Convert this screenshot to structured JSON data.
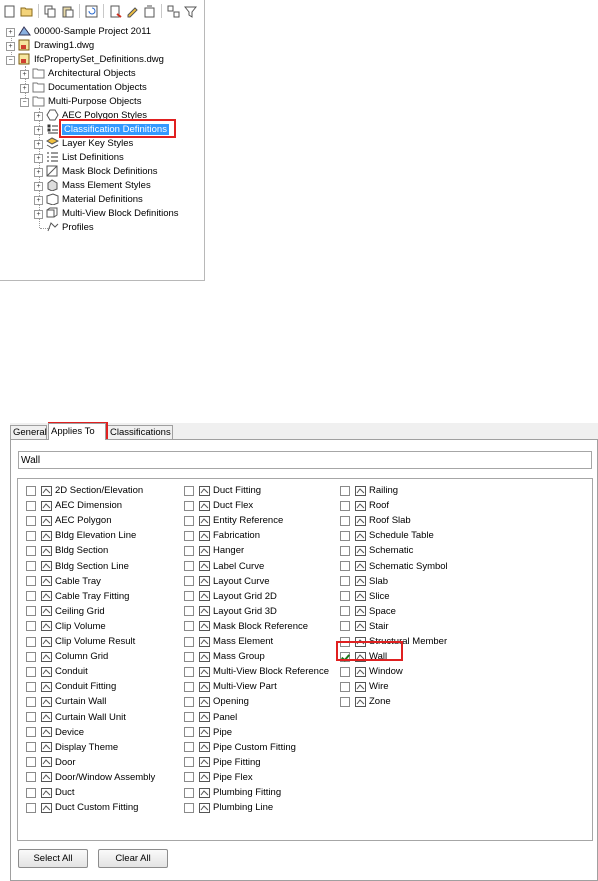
{
  "toolbar": {
    "icons": [
      "new-icon",
      "open-icon",
      "copy-icon",
      "paste-icon",
      "refresh-icon",
      "properties-icon",
      "rename-icon",
      "purge-icon",
      "manage-icon",
      "filter-icon"
    ]
  },
  "tree": {
    "items": [
      {
        "label": "00000-Sample Project 2011",
        "icon": "project-icon",
        "expander": "+"
      },
      {
        "label": "Drawing1.dwg",
        "icon": "drawing-icon",
        "expander": "+"
      },
      {
        "label": "IfcPropertySet_Definitions.dwg",
        "icon": "drawing-icon",
        "expander": "−"
      },
      {
        "label": "Architectural Objects",
        "icon": "folder-icon",
        "expander": "+"
      },
      {
        "label": "Documentation Objects",
        "icon": "folder-icon",
        "expander": "+"
      },
      {
        "label": "Multi-Purpose Objects",
        "icon": "folder-icon",
        "expander": "−"
      },
      {
        "label": "AEC Polygon Styles",
        "icon": "polygon-icon",
        "expander": "+"
      },
      {
        "label": "Classification Definitions",
        "icon": "classification-icon",
        "expander": "+",
        "selected": true
      },
      {
        "label": "Layer Key Styles",
        "icon": "layer-key-icon",
        "expander": "+"
      },
      {
        "label": "List Definitions",
        "icon": "list-icon",
        "expander": "+"
      },
      {
        "label": "Mask Block Definitions",
        "icon": "mask-block-icon",
        "expander": "+"
      },
      {
        "label": "Mass Element Styles",
        "icon": "mass-element-icon",
        "expander": "+"
      },
      {
        "label": "Material Definitions",
        "icon": "material-icon",
        "expander": "+"
      },
      {
        "label": "Multi-View Block Definitions",
        "icon": "multiview-block-icon",
        "expander": "+"
      },
      {
        "label": "Profiles",
        "icon": "profile-icon",
        "expander": ""
      }
    ]
  },
  "dialog": {
    "tabs": [
      "General",
      "Applies To",
      "Classifications"
    ],
    "active_tab": "Applies To",
    "filter_value": "Wall",
    "col1": [
      {
        "label": "2D Section/Elevation",
        "checked": false
      },
      {
        "label": "AEC Dimension",
        "checked": false
      },
      {
        "label": "AEC Polygon",
        "checked": false
      },
      {
        "label": "Bldg Elevation Line",
        "checked": false
      },
      {
        "label": "Bldg Section",
        "checked": false
      },
      {
        "label": "Bldg Section Line",
        "checked": false
      },
      {
        "label": "Cable Tray",
        "checked": false
      },
      {
        "label": "Cable Tray Fitting",
        "checked": false
      },
      {
        "label": "Ceiling Grid",
        "checked": false
      },
      {
        "label": "Clip Volume",
        "checked": false
      },
      {
        "label": "Clip Volume Result",
        "checked": false
      },
      {
        "label": "Column Grid",
        "checked": false
      },
      {
        "label": "Conduit",
        "checked": false
      },
      {
        "label": "Conduit Fitting",
        "checked": false
      },
      {
        "label": "Curtain Wall",
        "checked": false
      },
      {
        "label": "Curtain Wall Unit",
        "checked": false
      },
      {
        "label": "Device",
        "checked": false
      },
      {
        "label": "Display Theme",
        "checked": false
      },
      {
        "label": "Door",
        "checked": false
      },
      {
        "label": "Door/Window Assembly",
        "checked": false
      },
      {
        "label": "Duct",
        "checked": false
      },
      {
        "label": "Duct Custom Fitting",
        "checked": false
      }
    ],
    "col2": [
      {
        "label": "Duct Fitting",
        "checked": false
      },
      {
        "label": "Duct Flex",
        "checked": false
      },
      {
        "label": "Entity Reference",
        "checked": false
      },
      {
        "label": "Fabrication",
        "checked": false
      },
      {
        "label": "Hanger",
        "checked": false
      },
      {
        "label": "Label Curve",
        "checked": false
      },
      {
        "label": "Layout Curve",
        "checked": false
      },
      {
        "label": "Layout Grid 2D",
        "checked": false
      },
      {
        "label": "Layout Grid 3D",
        "checked": false
      },
      {
        "label": "Mask Block Reference",
        "checked": false
      },
      {
        "label": "Mass Element",
        "checked": false
      },
      {
        "label": "Mass Group",
        "checked": false
      },
      {
        "label": "Multi-View Block Reference",
        "checked": false
      },
      {
        "label": "Multi-View Part",
        "checked": false
      },
      {
        "label": "Opening",
        "checked": false
      },
      {
        "label": "Panel",
        "checked": false
      },
      {
        "label": "Pipe",
        "checked": false
      },
      {
        "label": "Pipe Custom Fitting",
        "checked": false
      },
      {
        "label": "Pipe Fitting",
        "checked": false
      },
      {
        "label": "Pipe Flex",
        "checked": false
      },
      {
        "label": "Plumbing Fitting",
        "checked": false
      },
      {
        "label": "Plumbing Line",
        "checked": false
      }
    ],
    "col3": [
      {
        "label": "Railing",
        "checked": false
      },
      {
        "label": "Roof",
        "checked": false
      },
      {
        "label": "Roof Slab",
        "checked": false
      },
      {
        "label": "Schedule Table",
        "checked": false
      },
      {
        "label": "Schematic",
        "checked": false
      },
      {
        "label": "Schematic Symbol",
        "checked": false
      },
      {
        "label": "Slab",
        "checked": false
      },
      {
        "label": "Slice",
        "checked": false
      },
      {
        "label": "Space",
        "checked": false
      },
      {
        "label": "Stair",
        "checked": false
      },
      {
        "label": "Structural Member",
        "checked": false
      },
      {
        "label": "Wall",
        "checked": true
      },
      {
        "label": "Window",
        "checked": false
      },
      {
        "label": "Wire",
        "checked": false
      },
      {
        "label": "Zone",
        "checked": false
      }
    ],
    "select_all_label": "Select All",
    "clear_all_label": "Clear All"
  },
  "colors": {
    "selection": "#3399ff",
    "highlight_box": "#e02020",
    "dialog_bg": "#f0f0f0"
  }
}
